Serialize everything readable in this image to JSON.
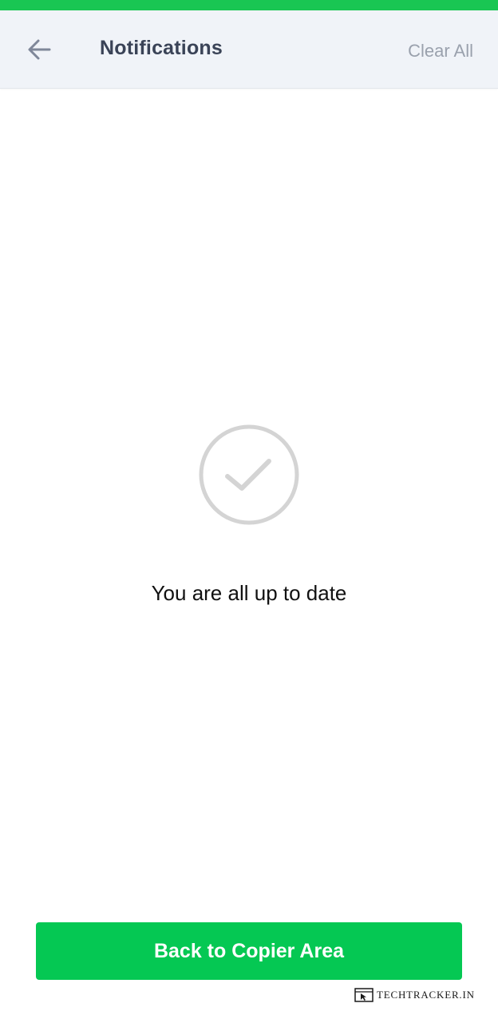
{
  "header": {
    "title": "Notifications",
    "clear_all_label": "Clear All"
  },
  "empty_state": {
    "message": "You are all up to date",
    "icon": "check-circle-icon"
  },
  "footer": {
    "button_label": "Back to Copier Area"
  },
  "watermark": {
    "text": "TECHTRACKER.IN"
  },
  "colors": {
    "accent_green": "#05c853",
    "status_strip": "#19c653",
    "header_bg": "#f0f3f8",
    "title_color": "#3a4357",
    "muted_text": "#9aa1ad",
    "icon_gray": "#d4d4d4"
  }
}
